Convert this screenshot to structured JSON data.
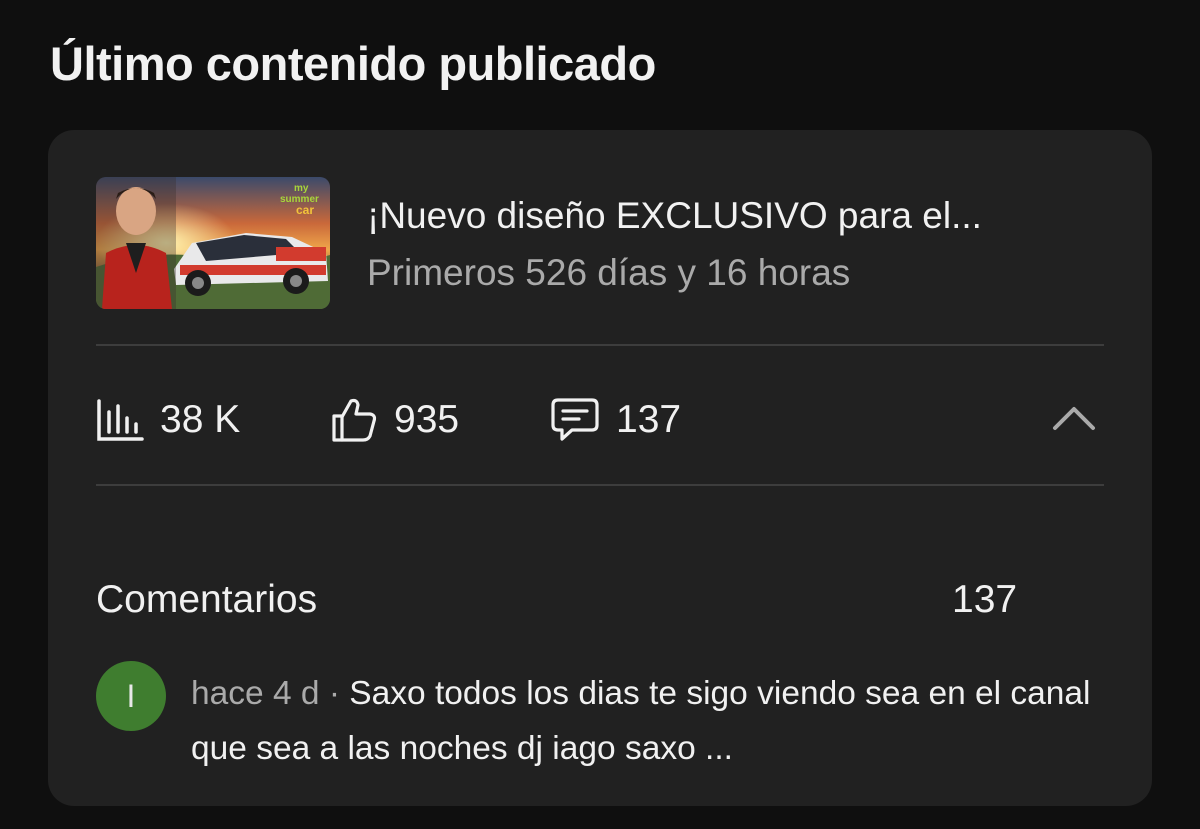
{
  "section": {
    "title": "Último contenido publicado"
  },
  "video": {
    "thumbnail": {
      "logo_line1": "my",
      "logo_line2": "summer",
      "logo_line3": "car"
    },
    "title": "¡Nuevo diseño EXCLUSIVO para el...",
    "subtitle": "Primeros 526 días y 16 horas"
  },
  "stats": {
    "views": {
      "icon": "bar-chart-icon",
      "value": "38 K"
    },
    "likes": {
      "icon": "thumbs-up-icon",
      "value": "935"
    },
    "comments": {
      "icon": "comment-icon",
      "value": "137"
    },
    "collapse_icon": "chevron-up-icon"
  },
  "comments": {
    "label": "Comentarios",
    "count": "137",
    "latest": {
      "avatar_letter": "I",
      "avatar_color": "#3f7d2f",
      "meta": "hace 4 d ·",
      "text": "Saxo todos los dias te sigo viendo sea en el canal que sea a las noches dj iago saxo ..."
    }
  },
  "colors": {
    "card_bg": "#212121",
    "page_bg": "#0f0f0f",
    "secondary_text": "#aaaaaa"
  }
}
